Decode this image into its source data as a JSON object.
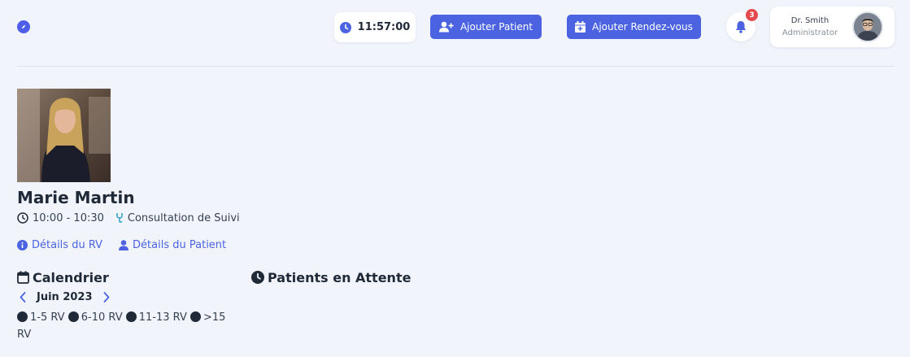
{
  "header": {
    "clock": "11:57:00",
    "add_patient_label": "Ajouter Patient",
    "add_appointment_label": "Ajouter Rendez-vous",
    "notification_count": "3",
    "user": {
      "name": "Dr. Smith",
      "role": "Administrator"
    }
  },
  "appointment": {
    "patient_name": "Marie Martin",
    "time": "10:00 - 10:30",
    "type": "Consultation de Suivi",
    "details_link": "Détails du RV",
    "patient_details_link": "Détails du Patient"
  },
  "calendar": {
    "title": "Calendrier",
    "month": "Juin 2023",
    "legend": [
      "1-5 RV",
      "6-10 RV",
      "11-13 RV",
      ">15 RV"
    ]
  },
  "waiting": {
    "title": "Patients en Attente"
  },
  "colors": {
    "accent": "#4b63e0",
    "background": "#f1f4fb",
    "badge": "#e5484d"
  }
}
